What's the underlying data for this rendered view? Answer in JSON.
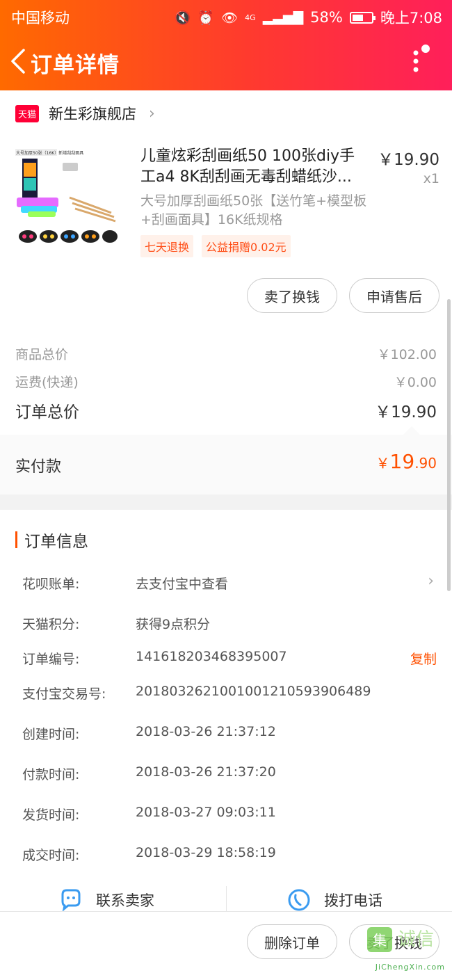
{
  "status_bar": {
    "carrier": "中国移动",
    "network": "4G",
    "battery": "58%",
    "battery_level": 0.58,
    "time": "晚上7:08"
  },
  "header": {
    "title": "订单详情"
  },
  "shop": {
    "badge": "天猫",
    "name": "新生彩旗舰店"
  },
  "product": {
    "title": "儿童炫彩刮画纸50 100张diy手工a4 8K刮刮画无毒刮蜡纸沙...",
    "price": "￥19.90",
    "qty": "x1",
    "spec": "大号加厚刮画纸50张【送竹笔+模型板+刮画面具】16K纸规格",
    "tags": [
      "七天退换",
      "公益捐赠0.02元"
    ],
    "thumb_text": "大号加厚50张（16K）新增刮刮面具"
  },
  "item_actions": {
    "sell": "卖了换钱",
    "after_sale": "申请售后"
  },
  "summary": {
    "goods_label": "商品总价",
    "goods_value": "￥102.00",
    "shipping_label": "运费(快递)",
    "shipping_value": "￥0.00",
    "total_label": "订单总价",
    "total_value": "￥19.90"
  },
  "paid": {
    "label": "实付款",
    "currency": "￥",
    "int": "19",
    "dec": ".90"
  },
  "order_info": {
    "title": "订单信息",
    "rows": [
      {
        "key": "花呗账单:",
        "value": "去支付宝中查看"
      },
      {
        "key": "天猫积分:",
        "value": "获得9点积分"
      },
      {
        "key": "订单编号:",
        "value": "141618203468395007",
        "action": "复制"
      },
      {
        "key": "支付宝交易号:",
        "value": "2018032621001001210593906489"
      },
      {
        "key": "创建时间:",
        "value": "2018-03-26 21:37:12"
      },
      {
        "key": "付款时间:",
        "value": "2018-03-26 21:37:20"
      },
      {
        "key": "发货时间:",
        "value": "2018-03-27 09:03:11"
      },
      {
        "key": "成交时间:",
        "value": "2018-03-29 18:58:19"
      }
    ]
  },
  "contact": {
    "seller": "联系卖家",
    "call": "拨打电话"
  },
  "bottom": {
    "delete": "删除订单",
    "sell": "卖了换钱"
  },
  "watermark": {
    "text": "JiChengXin.com"
  },
  "colors": {
    "accent": "#ff5000",
    "header_start": "#ff6a00",
    "header_end": "#ff1f5a",
    "tmall": "#ff0036"
  }
}
